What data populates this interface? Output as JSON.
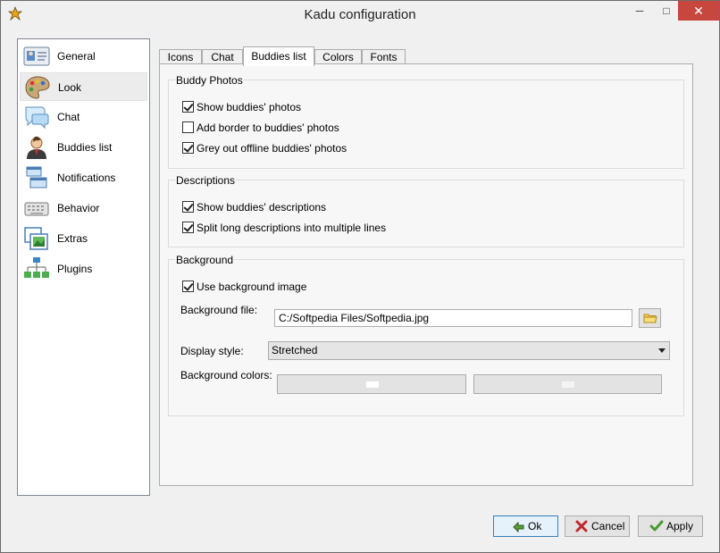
{
  "window": {
    "title": "Kadu configuration",
    "minimize": "─",
    "maximize": "□",
    "close": "✕"
  },
  "sidebar": {
    "items": [
      {
        "label": "General",
        "icon": "id-card-icon"
      },
      {
        "label": "Look",
        "icon": "palette-icon"
      },
      {
        "label": "Chat",
        "icon": "speech-bubble-icon"
      },
      {
        "label": "Buddies list",
        "icon": "person-icon"
      },
      {
        "label": "Notifications",
        "icon": "notification-windows-icon"
      },
      {
        "label": "Behavior",
        "icon": "keyboard-icon"
      },
      {
        "label": "Extras",
        "icon": "pictures-icon"
      },
      {
        "label": "Plugins",
        "icon": "plugin-tree-icon"
      }
    ],
    "selected": "Look"
  },
  "tabs": [
    "Icons",
    "Chat",
    "Buddies list",
    "Colors",
    "Fonts"
  ],
  "active_tab": "Buddies list",
  "buddy_photos": {
    "title": "Buddy Photos",
    "show_photos": {
      "label": "Show buddies' photos",
      "checked": true
    },
    "add_border": {
      "label": "Add border to buddies' photos",
      "checked": false
    },
    "grey_out": {
      "label": "Grey out offline buddies' photos",
      "checked": true
    }
  },
  "descriptions": {
    "title": "Descriptions",
    "show_descriptions": {
      "label": "Show buddies' descriptions",
      "checked": true
    },
    "split_long": {
      "label": "Split long descriptions into multiple lines",
      "checked": true
    }
  },
  "background": {
    "title": "Background",
    "use_image": {
      "label": "Use background image",
      "checked": true
    },
    "file_label": "Background file:",
    "file_value": "C:/Softpedia Files/Softpedia.jpg",
    "display_style_label": "Display style:",
    "display_style_value": "Stretched",
    "colors_label": "Background colors:"
  },
  "footer": {
    "ok": "Ok",
    "cancel": "Cancel",
    "apply": "Apply"
  },
  "colors": {
    "accent": "#3c7fb1",
    "close": "#c7463d"
  }
}
